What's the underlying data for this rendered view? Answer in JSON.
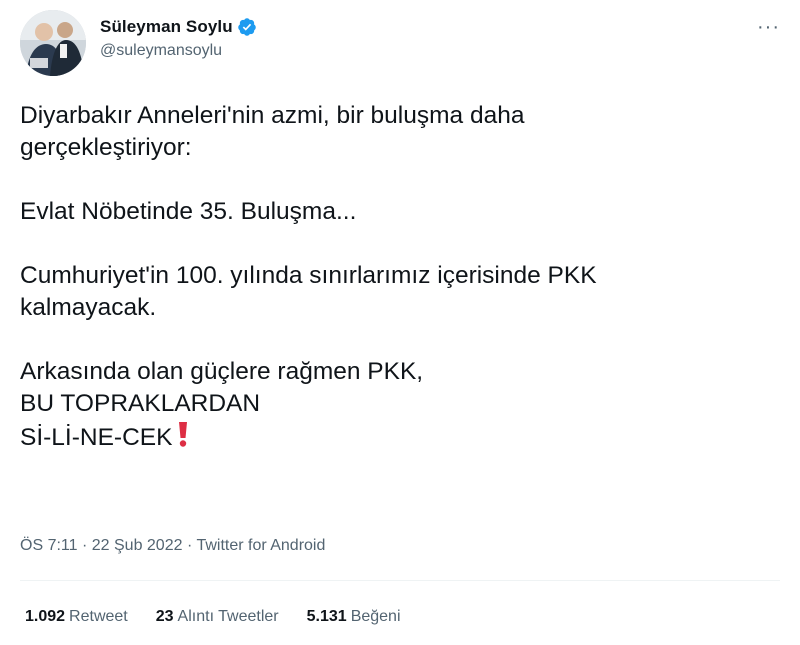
{
  "author": {
    "name": "Süleyman Soylu",
    "handle": "@suleymansoylu",
    "verified_color": "#1d9bf0"
  },
  "menu_icon": "more-horizontal-icon",
  "tweet": {
    "paragraphs": [
      [
        "Diyarbakır Anneleri'nin azmi, bir buluşma daha",
        "gerçekleştiriyor:"
      ],
      [
        "Evlat Nöbetinde 35. Buluşma..."
      ],
      [
        "Cumhuriyet'in 100. yılında sınırlarımız içerisinde PKK",
        "kalmayacak."
      ],
      [
        "Arkasında olan güçlere rağmen PKK,",
        "BU TOPRAKLARDAN",
        "Sİ-Lİ-NE-CEK"
      ]
    ],
    "emoji": "red-exclamation-mark-icon",
    "emoji_color": "#dd2e44"
  },
  "meta": {
    "time": "ÖS 7:11",
    "date": "22 Şub 2022",
    "source": "Twitter for Android",
    "separator": "·"
  },
  "stats": {
    "retweets": {
      "count": "1.092",
      "label": "Retweet"
    },
    "quotes": {
      "count": "23",
      "label": "Alıntı Tweetler"
    },
    "likes": {
      "count": "5.131",
      "label": "Beğeni"
    }
  }
}
